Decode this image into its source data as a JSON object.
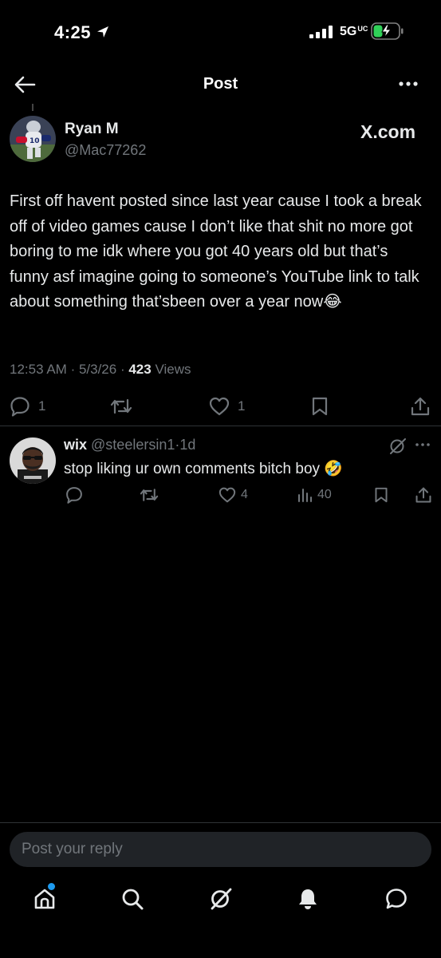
{
  "status_bar": {
    "time": "4:25",
    "network": "5G",
    "network_sup": "UC"
  },
  "header": {
    "title": "Post"
  },
  "post": {
    "author_name": "Ryan M",
    "author_handle": "@Mac77262",
    "source": "X.com",
    "text": "First off havent posted since last year cause I took a break off of video games cause I don’t like that shit no more got boring to me idk where you got 40 years old but that’s funny asf imagine going to someone’s YouTube link to talk about something that’sbeen over a year now😂",
    "time": "12:53 AM",
    "date": "5/3/26",
    "views_count": "423",
    "views_label": "Views",
    "replies": "1",
    "likes": "1"
  },
  "reply": {
    "name": "wix",
    "handle": "@steelersin1",
    "age": "1d",
    "text": "stop liking ur own comments bitch boy 🤣",
    "likes": "4",
    "views": "40"
  },
  "composer": {
    "placeholder": "Post your reply"
  },
  "icons": {
    "back": "arrow-left-icon",
    "more": "more-dots-icon",
    "reply": "comment-icon",
    "repost": "repost-icon",
    "like": "heart-icon",
    "bookmark": "bookmark-icon",
    "share": "share-icon",
    "views": "views-icon",
    "grok": "grok-icon",
    "home": "home-icon",
    "search": "search-icon",
    "notifications": "bell-icon",
    "messages": "message-icon"
  },
  "colors": {
    "accent": "#1d9bf0",
    "background": "#000000",
    "secondary_text": "#71767b",
    "battery": "#30d158"
  }
}
